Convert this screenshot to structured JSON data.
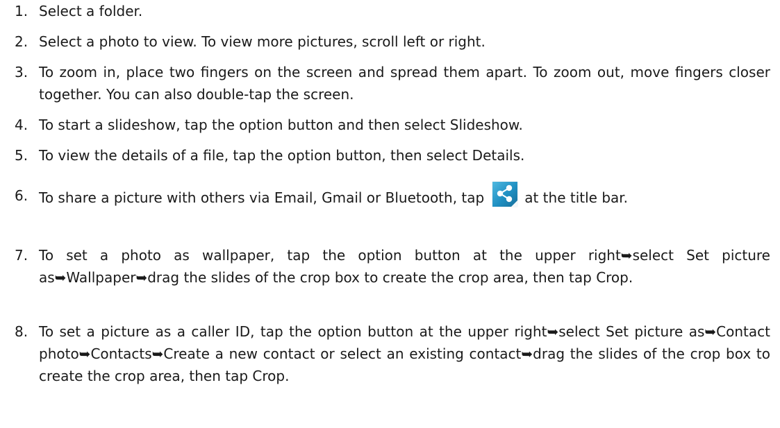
{
  "steps": [
    {
      "num": "1.",
      "text": "Select a folder."
    },
    {
      "num": "2.",
      "text": "Select a photo to view. To view more pictures, scroll left or right."
    },
    {
      "num": "3.",
      "text": "To zoom in, place two fingers on the screen and spread them apart. To zoom out, move fingers closer together. You can also double-tap the screen."
    },
    {
      "num": "4.",
      "text": "To start a slideshow, tap the option button and then select Slideshow."
    },
    {
      "num": "5.",
      "text": "To view the details of a file, tap the option button, then select Details."
    },
    {
      "num": "6.",
      "text_before": "To share a picture with others via Email, Gmail or Bluetooth, tap",
      "text_after": "at the title bar.",
      "icon": "share-icon"
    },
    {
      "num": "7.",
      "text": "To set a photo as wallpaper, tap the option button at the upper right➥select Set picture as➥Wallpaper➥drag the slides of the crop box to create the crop area, then tap Crop."
    },
    {
      "num": "8.",
      "text": "To set a picture as a caller ID, tap the option button at the upper right➥select Set picture as➥Contact photo➥Contacts➥Create a new contact or select an existing contact➥drag the slides of the crop box to create the crop area, then tap Crop."
    }
  ],
  "colors": {
    "text": "#1a1a1a",
    "icon_bg": "#1f8fc2"
  }
}
